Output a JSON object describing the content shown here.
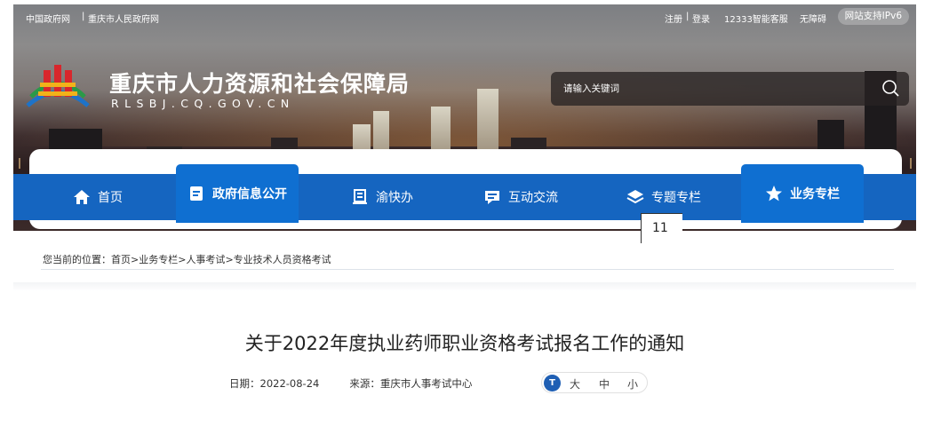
{
  "topbar": {
    "left_links": [
      "中国政府网",
      "重庆市人民政府网"
    ],
    "left_sep": "|",
    "register": "注册",
    "login": "登录",
    "sep": "|",
    "hotline": "12333智能客服",
    "accessibility": "无障碍",
    "ipv6": "网站支持IPv6"
  },
  "site": {
    "title": "重庆市人力资源和社会保障局",
    "domain": "RLSBJ.CQ.GOV.CN"
  },
  "search": {
    "placeholder": "请输入关键词",
    "icon": "search-icon"
  },
  "nav": {
    "items": [
      {
        "label": "首页",
        "icon": "home-icon"
      },
      {
        "label": "政府信息公开",
        "icon": "document-icon",
        "active": true
      },
      {
        "label": "渝快办",
        "icon": "id-card-icon"
      },
      {
        "label": "互动交流",
        "icon": "chat-icon"
      },
      {
        "label": "专题专栏",
        "icon": "layers-icon"
      },
      {
        "label": "业务专栏",
        "icon": "star-icon",
        "active": true
      }
    ]
  },
  "tooltip": {
    "value": "11"
  },
  "breadcrumb": {
    "prefix": "您当前的位置：",
    "items": [
      "首页",
      "业务专栏",
      "人事考试",
      "专业技术人员资格考试"
    ],
    "sep": ">"
  },
  "article": {
    "title": "关于2022年度执业药师职业资格考试报名工作的通知",
    "date_label": "日期：",
    "date": "2022-08-24",
    "source_label": "来源：",
    "source": "重庆市人事考试中心",
    "font_sizes": [
      "大",
      "中",
      "小"
    ],
    "font_icon": "font-size-icon"
  },
  "colors": {
    "nav_blue": "#1565c0",
    "nav_active": "#0f6fd1",
    "font_icon_blue": "#1f5fb4"
  }
}
